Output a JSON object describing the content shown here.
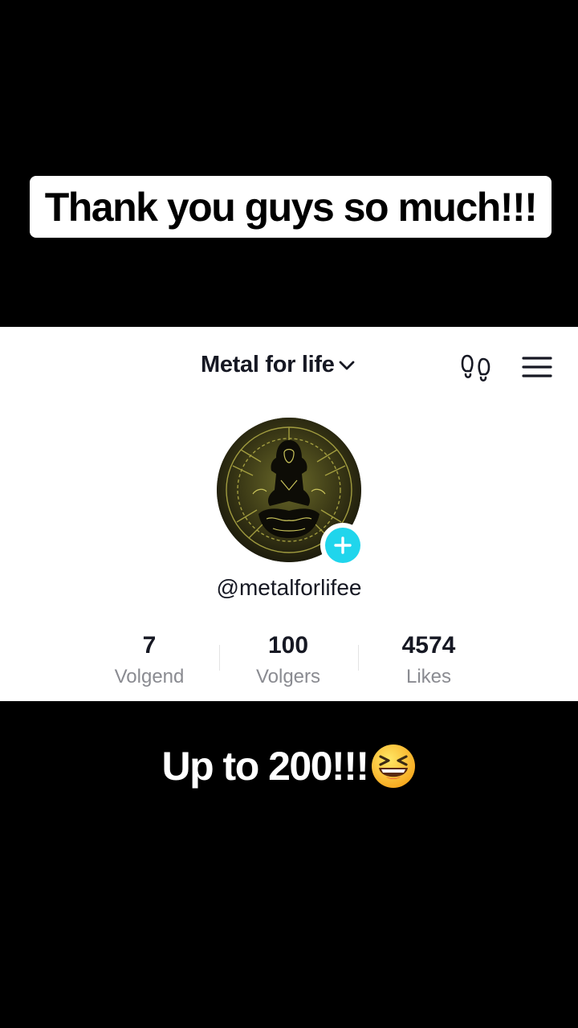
{
  "overlay": {
    "top_caption": "Thank you guys so much!!!",
    "bottom_caption": "Up to 200!!!",
    "bottom_emoji": "grinning-squinting-face-emoji"
  },
  "header": {
    "title": "Metal for life",
    "dropdown_icon": "chevron-down-icon",
    "visitors_icon": "footprints-icon",
    "menu_icon": "hamburger-menu-icon"
  },
  "profile": {
    "username": "@metalforlifee",
    "add_icon": "plus-icon",
    "accent_color": "#20d5ec"
  },
  "stats": [
    {
      "value": "7",
      "label": "Volgend"
    },
    {
      "value": "100",
      "label": "Volgers"
    },
    {
      "value": "4574",
      "label": "Likes"
    }
  ]
}
